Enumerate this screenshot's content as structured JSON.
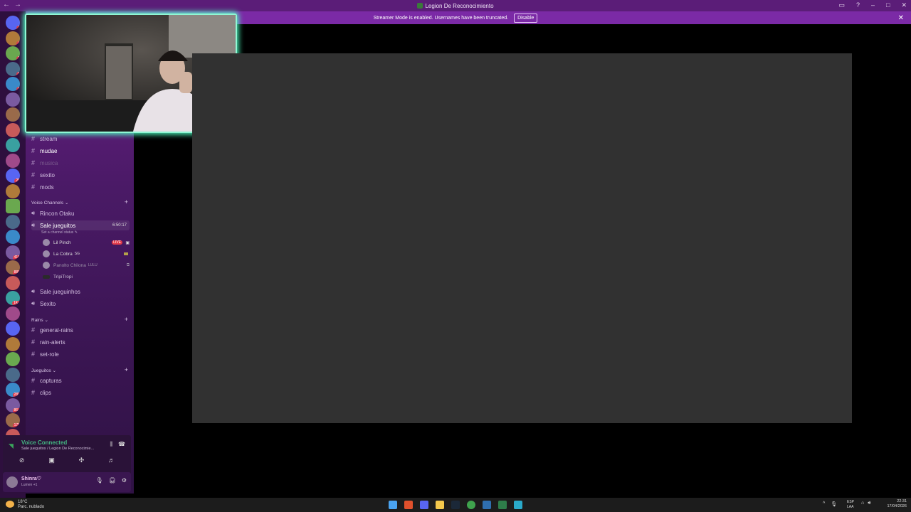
{
  "window": {
    "title": "Legion De Reconocimiento",
    "controls": [
      "minimize",
      "maximize",
      "close"
    ]
  },
  "banner": {
    "message": "Streamer Mode is enabled. Usernames have been truncated.",
    "disable_label": "Disable"
  },
  "channels": [
    {
      "name": "stream",
      "state": "normal"
    },
    {
      "name": "mudae",
      "state": "active"
    },
    {
      "name": "musica",
      "state": "muted"
    },
    {
      "name": "sexito",
      "state": "normal"
    },
    {
      "name": "mods",
      "state": "normal"
    }
  ],
  "voice_category": {
    "label": "Voice Channels"
  },
  "voice_channels": {
    "rincon": "Rincon Otaku",
    "sale": {
      "name": "Sale jueguitos",
      "timer": "6:50:17",
      "status": "Set a channel status"
    },
    "users": [
      {
        "name": "Lil Pinch",
        "badge": "LIVE"
      },
      {
        "name": "La Cobra",
        "tag": "SG"
      },
      {
        "name": "Panolto Chilona",
        "tag": "LULU"
      },
      {
        "name": "TripiTropi"
      }
    ],
    "jueguinhos": "Sale jueguinhos",
    "sexito": "Sexito"
  },
  "rains_category": {
    "label": "Rains"
  },
  "rains_channels": [
    "general-rains",
    "rain-alerts",
    "set-role"
  ],
  "jueguitos_category": {
    "label": "Jueguitos"
  },
  "jueguitos_channels": [
    "capturas",
    "clips"
  ],
  "voice_connected": {
    "title": "Voice Connected",
    "subtitle": "Sale jueguitos / Legion De Reconocimie..."
  },
  "user_panel": {
    "name": "Shinra♡",
    "status": "Lumen +1"
  },
  "taskbar": {
    "weather_temp": "18°C",
    "weather_desc": "Parc. nublado",
    "lang_top": "ESP",
    "lang_bottom": "LAA",
    "time": "22:31",
    "date": "17/04/2026"
  },
  "server_badges": [
    "3",
    "4",
    "1",
    "8",
    "6",
    "",
    "",
    "",
    "",
    "",
    "25",
    "",
    "",
    "",
    "",
    "416",
    "888",
    "",
    "1K+",
    "",
    "",
    "",
    "",
    "",
    "284",
    "86+",
    "178",
    "",
    "170",
    "328",
    ""
  ],
  "colors": {
    "accent": "#5865f2",
    "banner": "#7b2aa6",
    "titlebar": "#5b1d78",
    "live": "#e23b4a",
    "video_glow": "#4effc2",
    "stage": "#313131"
  }
}
